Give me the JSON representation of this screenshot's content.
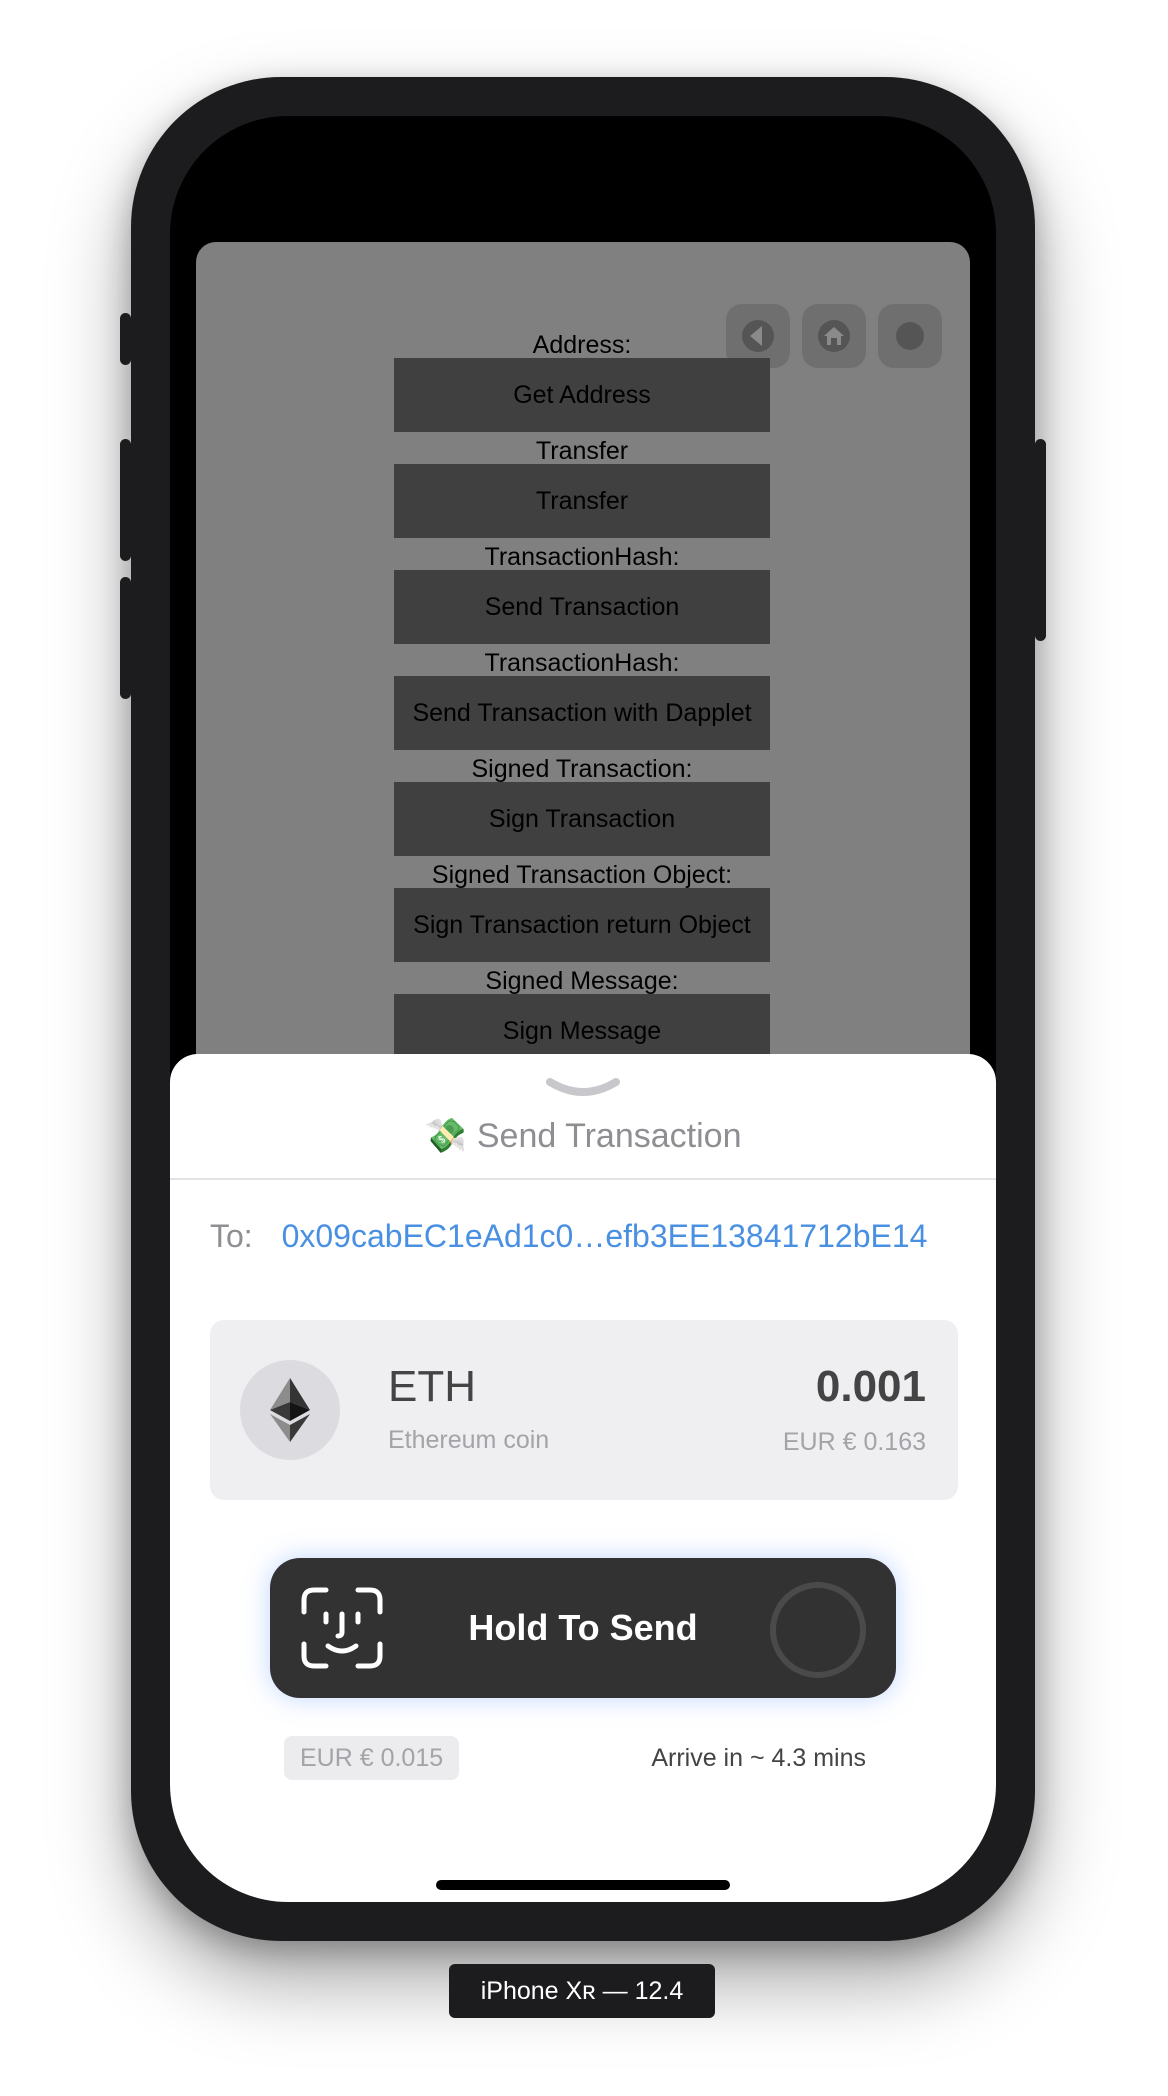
{
  "app": {
    "rows": [
      {
        "label": "Address:",
        "button": "Get Address"
      },
      {
        "label": "Transfer",
        "button": "Transfer"
      },
      {
        "label": "TransactionHash:",
        "button": "Send Transaction"
      },
      {
        "label": "TransactionHash:",
        "button": "Send Transaction with Dapplet"
      },
      {
        "label": "Signed Transaction:",
        "button": "Sign Transaction"
      },
      {
        "label": "Signed Transaction Object:",
        "button": "Sign Transaction return Object"
      },
      {
        "label": "Signed Message:",
        "button": "Sign Message"
      }
    ],
    "floating_buttons": [
      "back-icon",
      "home-icon",
      "record-icon"
    ]
  },
  "sheet": {
    "title_emoji": "💸",
    "title": "Send Transaction",
    "to_label": "To:",
    "to_address": "0x09cabEC1eAd1c0…efb3EE13841712bE14",
    "coin": {
      "symbol": "ETH",
      "name": "Ethereum coin",
      "amount": "0.001",
      "fiat": "EUR € 0.163",
      "icon": "ethereum-icon"
    },
    "hold_button": "Hold To Send",
    "fee": "EUR € 0.015",
    "eta": "Arrive in ~ 4.3 mins"
  },
  "device_label": "iPhone Xʀ — 12.4",
  "colors": {
    "link": "#4a90e2",
    "button_dark": "#323232",
    "app_bg": "#808080"
  }
}
